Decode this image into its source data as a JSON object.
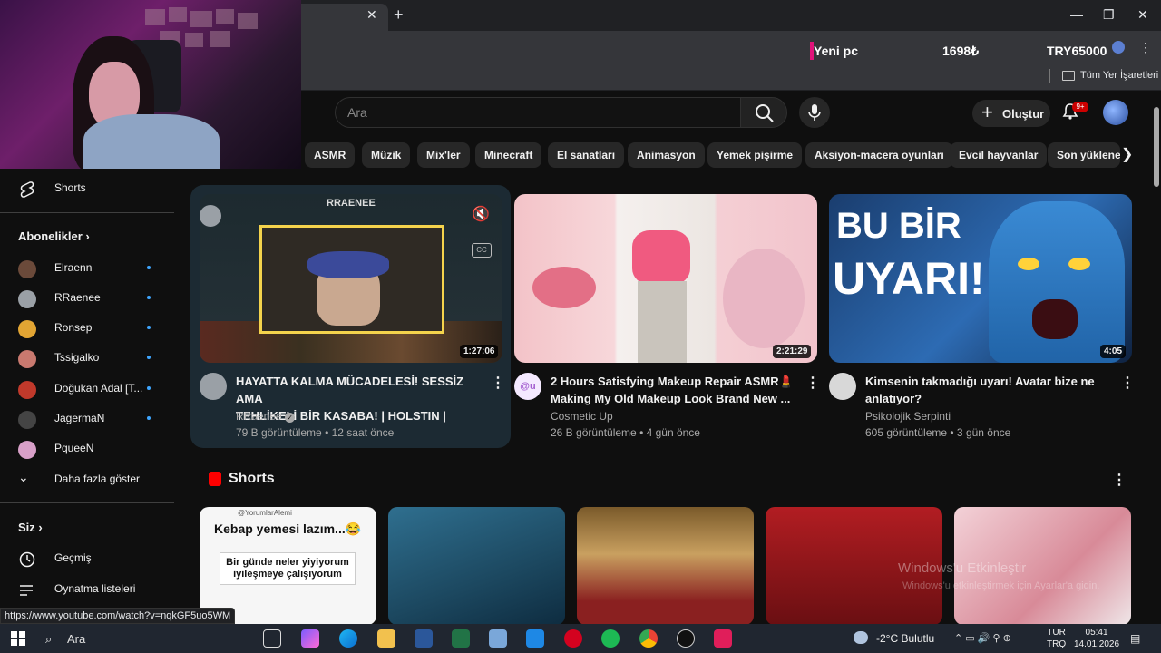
{
  "browser": {
    "new_tab_icon": "plus-icon",
    "ticker": {
      "label": "Yeni pc",
      "amount": "1698₺",
      "target": "TRY65000"
    },
    "bookmarks_label": "Tüm Yer İşaretleri",
    "status_url": "https://www.youtube.com/watch?v=nqkGF5uo5WM"
  },
  "header": {
    "search_placeholder": "Ara",
    "create_label": "Oluştur",
    "notifications_badge": "9+"
  },
  "chips": [
    "ASMR",
    "Müzik",
    "Mix'ler",
    "Minecraft",
    "El sanatları",
    "Animasyon",
    "Yemek pişirme",
    "Aksiyon-macera oyunları",
    "Evcil hayvanlar",
    "Son yüklenenler"
  ],
  "sidebar": {
    "shorts_label": "Shorts",
    "subscriptions_title": "Abonelikler",
    "subscriptions": [
      {
        "name": "Elraenn",
        "color": "#6b4a3a"
      },
      {
        "name": "RRaenee",
        "color": "#9aa0a6"
      },
      {
        "name": "Ronsep",
        "color": "#e2a533"
      },
      {
        "name": "Tssigalko",
        "color": "#c9796f"
      },
      {
        "name": "Doğukan Adal [T...",
        "color": "#c0392b"
      },
      {
        "name": "JagermaN",
        "color": "#444444"
      },
      {
        "name": "PqueeN",
        "color": "#d8a0c8"
      }
    ],
    "show_more": "Daha fazla göster",
    "you_title": "Siz",
    "history": "Geçmiş",
    "playlists": "Oynatma listeleri"
  },
  "videos": [
    {
      "title1": "HAYATTA KALMA MÜCADELESİ! SESSİZ AMA",
      "title2": "TEHLİKELİ BİR KASABA! | HOLSTIN |",
      "channel": "RRaenee",
      "verified": true,
      "meta": "79 B görüntüleme • 12 saat önce",
      "duration": "1:27:06",
      "thumb_text": "RRAENEE"
    },
    {
      "title1": "2 Hours Satisfying Makeup Repair ASMR💄",
      "title2": "Making My Old Makeup Look Brand New ...",
      "channel": "Cosmetic Up",
      "verified": false,
      "meta": "26 B görüntüleme • 4 gün önce",
      "duration": "2:21:29",
      "avatar_text": "@u"
    },
    {
      "title1": "Kimsenin takmadığı uyarı! Avatar bize ne",
      "title2": "anlatıyor?",
      "channel": "Psikolojik Serpinti",
      "verified": false,
      "meta": "605 görüntüleme • 3 gün önce",
      "duration": "4:05",
      "thumb_line1": "BU BİR",
      "thumb_line2": "UYARI!"
    }
  ],
  "shorts": {
    "title": "Shorts",
    "first_handle": "@YorumlarAlemi",
    "first_headline": "Kebap yemesi lazım...😂",
    "first_caption": "Bir günde neler yiyiyorum iyileşmeye çalışıyorum"
  },
  "watermark": {
    "line1": "Windows'u Etkinleştir",
    "line2": "Windows'u etkinleştirmek için Ayarlar'a gidin."
  },
  "taskbar": {
    "search": "Ara",
    "weather": "-2°C  Bulutlu",
    "lang1": "TUR",
    "lang2": "TRQ",
    "time": "05:41",
    "date": "14.01.2026"
  }
}
